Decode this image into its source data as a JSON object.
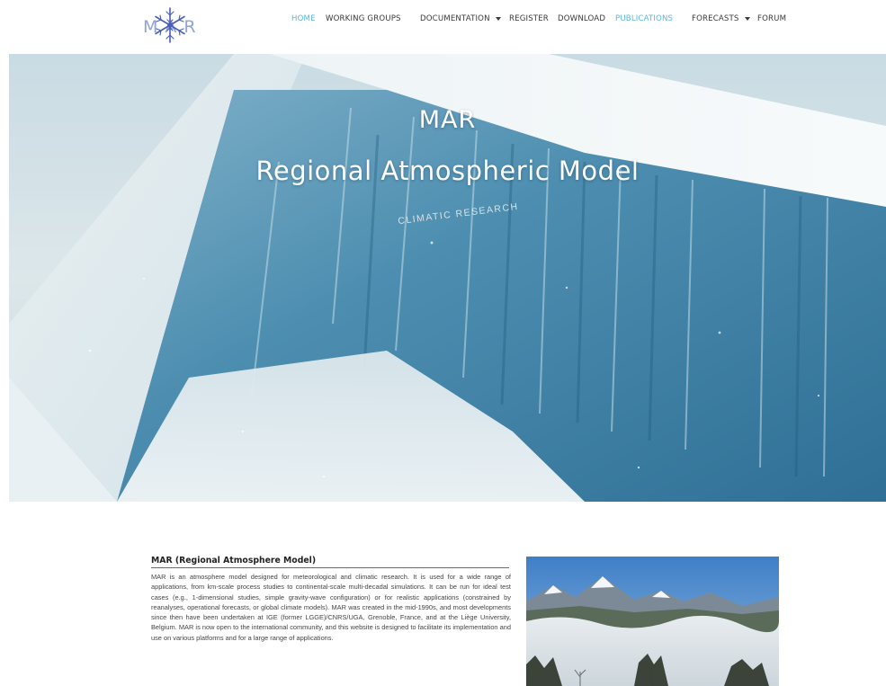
{
  "header": {
    "logo": {
      "text": "MAR",
      "icon": "snowflake-icon"
    },
    "nav": [
      {
        "label": "HOME",
        "active": true,
        "dropdown": false
      },
      {
        "label": "WORKING GROUPS",
        "active": false,
        "dropdown": false
      },
      {
        "label": "DOCUMENTATION",
        "active": false,
        "dropdown": true
      },
      {
        "label": "REGISTER",
        "active": false,
        "dropdown": false
      },
      {
        "label": "DOWNLOAD",
        "active": false,
        "dropdown": false
      },
      {
        "label": "PUBLICATIONS",
        "active": true,
        "dropdown": false
      },
      {
        "label": "FORECASTS",
        "active": false,
        "dropdown": true
      },
      {
        "label": "FORUM",
        "active": false,
        "dropdown": false
      }
    ]
  },
  "hero": {
    "title": "MAR",
    "subtitle": "Regional Atmospheric Model",
    "tag": "CLIMATIC RESEARCH"
  },
  "intro": {
    "title": "MAR (Regional Atmosphere Model)",
    "body": "MAR is an atmosphere model designed for meteorological and climatic research. It is used for a wide range of applications, from km-scale process studies to continental-scale multi-decadal simulations. It can be run for ideal test cases (e.g., 1-dimensional studies, simple gravity-wave configuration) or for realistic applications (constrained by reanalyses, operational forecasts, or global climate models). MAR was created in the mid-1990s, and most developments since then have been undertaken at IGE (former LGGE)/CNRS/UGA, Grenoble, France, and at the Liège University, Belgium. MAR is now open to the international community, and this website is designed to facilitate its implementation and use on various platforms and for a large range of applications."
  },
  "colors": {
    "active_nav": "#58b6e0",
    "nav_text": "#3a3a3a",
    "logo": "#5a6fc0"
  }
}
